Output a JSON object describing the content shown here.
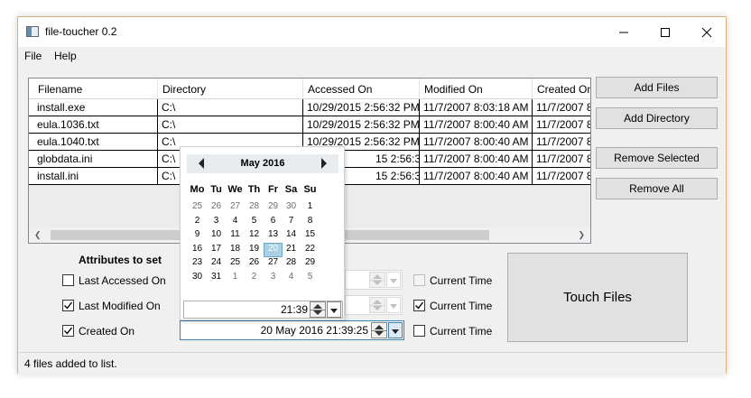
{
  "window": {
    "title": "file-toucher 0.2"
  },
  "menu": {
    "items": [
      "File",
      "Help"
    ]
  },
  "grid": {
    "columns": [
      "Filename",
      "Directory",
      "Accessed On",
      "Modified On",
      "Created On"
    ],
    "rows": [
      [
        "install.exe",
        "C:\\",
        "10/29/2015 2:56:32 PM",
        "11/7/2007 8:03:18 AM",
        "11/7/2007 8:"
      ],
      [
        "eula.1036.txt",
        "C:\\",
        "10/29/2015 2:56:32 PM",
        "11/7/2007 8:00:40 AM",
        "11/7/2007 8:"
      ],
      [
        "eula.1040.txt",
        "C:\\",
        "10/29/2015 2:56:32 PM",
        "11/7/2007 8:00:40 AM",
        "11/7/2007 8:"
      ],
      [
        "globdata.ini",
        "C:\\",
        "15 2:56:32 PM",
        "11/7/2007 8:00:40 AM",
        "11/7/2007 8:"
      ],
      [
        "install.ini",
        "C:\\",
        "15 2:56:32 PM",
        "11/7/2007 8:00:40 AM",
        "11/7/2007 8:"
      ]
    ]
  },
  "buttons": {
    "add_files": "Add Files",
    "add_directory": "Add Directory",
    "remove_selected": "Remove Selected",
    "remove_all": "Remove All",
    "touch_files": "Touch Files"
  },
  "attributes": {
    "title": "Attributes to set",
    "items": [
      {
        "label": "Last Accessed On",
        "checked": false,
        "value": "",
        "current_time_label": "Current Time",
        "current_time_checked": false,
        "current_time_disabled": true
      },
      {
        "label": "Last Modified On",
        "checked": true,
        "value": "",
        "current_time_label": "Current Time",
        "current_time_checked": true,
        "current_time_disabled": false
      },
      {
        "label": "Created On",
        "checked": true,
        "value": "20 May 2016 21:39:25",
        "current_time_label": "Current Time",
        "current_time_checked": false,
        "current_time_disabled": false
      }
    ]
  },
  "calendar": {
    "month_label": "May 2016",
    "weekdays": [
      "Mo",
      "Tu",
      "We",
      "Th",
      "Fr",
      "Sa",
      "Su"
    ],
    "weeks": [
      [
        "25",
        "26",
        "27",
        "28",
        "29",
        "30",
        "1"
      ],
      [
        "2",
        "3",
        "4",
        "5",
        "6",
        "7",
        "8"
      ],
      [
        "9",
        "10",
        "11",
        "12",
        "13",
        "14",
        "15"
      ],
      [
        "16",
        "17",
        "18",
        "19",
        "20",
        "21",
        "22"
      ],
      [
        "23",
        "24",
        "25",
        "26",
        "27",
        "28",
        "29"
      ],
      [
        "30",
        "31",
        "1",
        "2",
        "3",
        "4",
        "5"
      ]
    ],
    "selected_day": "20",
    "time_value": "21:39"
  },
  "status": {
    "text": "4 files added to list."
  },
  "colors": {
    "accent": "#3c7fb1",
    "selected_day": "#a8cfe2",
    "window_border": "#d8b27a"
  }
}
